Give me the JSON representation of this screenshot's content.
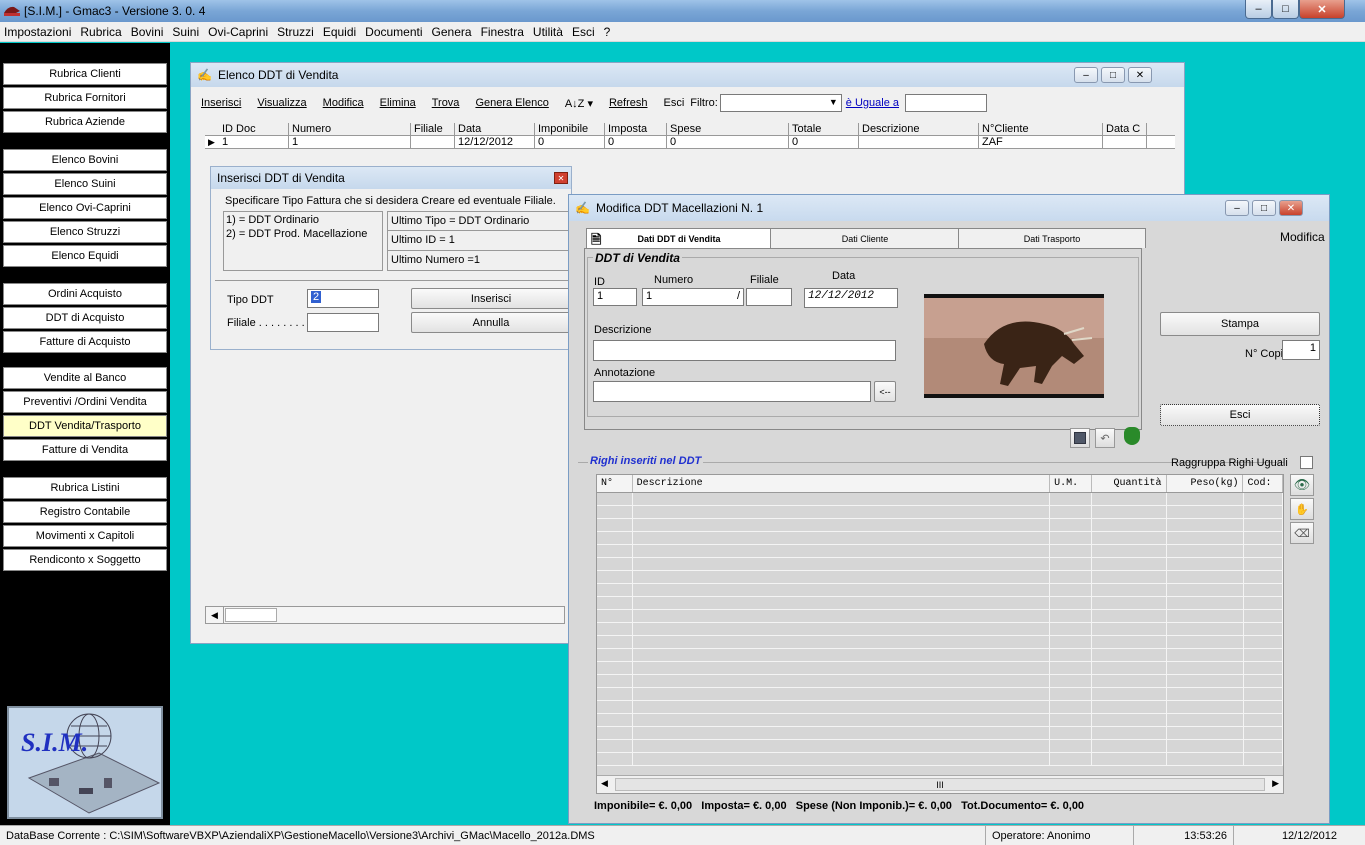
{
  "app": {
    "title": "[S.I.M.] - Gmac3 - Versione 3. 0. 4",
    "min": "–",
    "max": "□",
    "close": "✕"
  },
  "menu": [
    "Impostazioni",
    "Rubrica",
    "Bovini",
    "Suini",
    "Ovi-Caprini",
    "Struzzi",
    "Equidi",
    "Documenti",
    "Genera",
    "Finestra",
    "Utilità",
    "Esci",
    "?"
  ],
  "nav": [
    {
      "label": "Rubrica Clienti",
      "active": false
    },
    {
      "label": "Rubrica Fornitori",
      "active": false
    },
    {
      "label": "Rubrica Aziende",
      "active": false
    },
    {
      "label": "Elenco Bovini",
      "active": false
    },
    {
      "label": "Elenco Suini",
      "active": false
    },
    {
      "label": "Elenco Ovi-Caprini",
      "active": false
    },
    {
      "label": "Elenco Struzzi",
      "active": false
    },
    {
      "label": "Elenco Equidi",
      "active": false
    },
    {
      "label": "Ordini Acquisto",
      "active": false
    },
    {
      "label": "DDT di Acquisto",
      "active": false
    },
    {
      "label": "Fatture di Acquisto",
      "active": false
    },
    {
      "label": "Vendite al Banco",
      "active": false
    },
    {
      "label": "Preventivi /Ordini Vendita",
      "active": false
    },
    {
      "label": "DDT Vendita/Trasporto",
      "active": true
    },
    {
      "label": "Fatture di Vendita",
      "active": false
    },
    {
      "label": "Rubrica Listini",
      "active": false
    },
    {
      "label": "Registro Contabile",
      "active": false
    },
    {
      "label": "Movimenti x Capitoli",
      "active": false
    },
    {
      "label": "Rendiconto x Soggetto",
      "active": false
    }
  ],
  "logo_text": "S.I.M.",
  "elenco": {
    "title": "Elenco DDT di Vendita",
    "toolbar": {
      "inserisci": "Inserisci",
      "visualizza": "Visualizza",
      "modifica": "Modifica",
      "elimina": "Elimina",
      "trova": "Trova",
      "genera": "Genera Elenco",
      "sort": "A↓Z ▾",
      "refresh": "Refresh",
      "esci": "Esci",
      "filtro_label": "Filtro:",
      "filtro_value": "",
      "operator": "è Uguale a",
      "filtro_text": ""
    },
    "columns": [
      "ID Doc",
      "Numero",
      "Filiale",
      "Data",
      "Imponibile",
      "Imposta",
      "Spese",
      "Totale",
      "Descrizione",
      "N°Cliente",
      "Data C"
    ],
    "rows": [
      [
        "1",
        "1",
        "",
        "12/12/2012",
        "0",
        "0",
        "0",
        "0",
        "",
        "ZAF",
        ""
      ]
    ]
  },
  "inserisci": {
    "title": "Inserisci DDT di Vendita",
    "intro": "Specificare Tipo Fattura che si desidera Creare ed eventuale Filiale.",
    "options": [
      "1) = DDT Ordinario",
      "2) = DDT Prod. Macellazione"
    ],
    "ultimo_tipo": "Ultimo Tipo = DDT Ordinario",
    "ultimo_id": "Ultimo ID = 1",
    "ultimo_numero": "Ultimo Numero =1",
    "tipo_label": "Tipo DDT",
    "tipo_value": "2",
    "filiale_label": "Filiale . . . . . . . .",
    "filiale_value": "",
    "btn_inserisci": "Inserisci",
    "btn_annulla": "Annulla"
  },
  "modifica": {
    "title": "Modifica DDT Macellazioni N. 1",
    "mode": "Modifica",
    "tabs": [
      "Dati DDT di Vendita",
      "Dati Cliente",
      "Dati Trasporto"
    ],
    "group_title": "DDT di Vendita",
    "id_label": "ID",
    "numero_label": "Numero",
    "filiale_label": "Filiale",
    "data_label": "Data",
    "id_value": "1",
    "numero_value": "1",
    "slash": "/",
    "filiale_value": "",
    "data_value": "12/12/2012",
    "descrizione_label": "Descrizione",
    "descrizione_value": "",
    "annotazione_label": "Annotazione",
    "annotazione_value": "",
    "arrow_btn": "<--",
    "stampa": "Stampa",
    "copie_label": "N° Copie",
    "copie_value": "1",
    "esci": "Esci",
    "righe_title": "Righi inseriti nel DDT",
    "raggruppa": "Raggruppa Righi Uguali",
    "righe_columns": [
      "N°",
      "Descrizione",
      "U.M.",
      "Quantità",
      "Peso(kg)",
      "Cod:"
    ],
    "scroll_mid": "III",
    "totals": "Imponibile= €. 0,00   Imposta= €. 0,00   Spese (Non Imponib.)= €. 0,00   Tot.Documento= €. 0,00"
  },
  "status": {
    "db": "DataBase Corrente : C:\\SIM\\SoftwareVBXP\\AziendaliXP\\GestioneMacello\\Versione3\\Archivi_GMac\\Macello_2012a.DMS",
    "operatore": "Operatore: Anonimo",
    "time": "13:53:26",
    "date": "12/12/2012"
  }
}
